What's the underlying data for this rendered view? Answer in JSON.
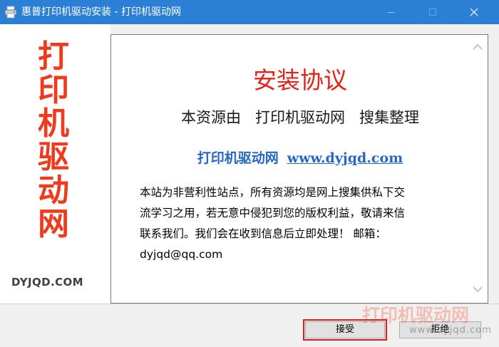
{
  "window": {
    "title": "惠普打印机驱动安装 - 打印机驱动网",
    "title_bar_color": "#2b7fd4"
  },
  "sidebar": {
    "brand_chars": [
      "打",
      "印",
      "机",
      "驱",
      "动",
      "网"
    ],
    "brand_domain": "DYJQD.COM",
    "brand_color": "#f03a1e"
  },
  "agreement": {
    "title": "安装协议",
    "subtitle": "本资源由   打印机驱动网   搜集整理",
    "site_name": "打印机驱动网",
    "site_url": "www.dyjqd.com",
    "body": "本站为非营利性站点，所有资源均是网上搜集供私下交流学习之用，若无意中侵犯到您的版权利益，敬请来信联系我们。我们会在收到信息后立即处理！  邮箱：dyjqd@qq.com",
    "title_color": "#e2231a",
    "link_color": "#2867c3"
  },
  "buttons": {
    "accept": "接受",
    "reject": "拒绝"
  },
  "watermark": {
    "main": "打印机驱动网",
    "sub": "www.dyjqd.com"
  },
  "icons": {
    "app": "printer-app-icon",
    "minimize": "minimize-icon",
    "maximize": "maximize-icon",
    "close": "close-icon",
    "scroll_up": "chevron-up-icon",
    "scroll_down": "chevron-down-icon"
  }
}
